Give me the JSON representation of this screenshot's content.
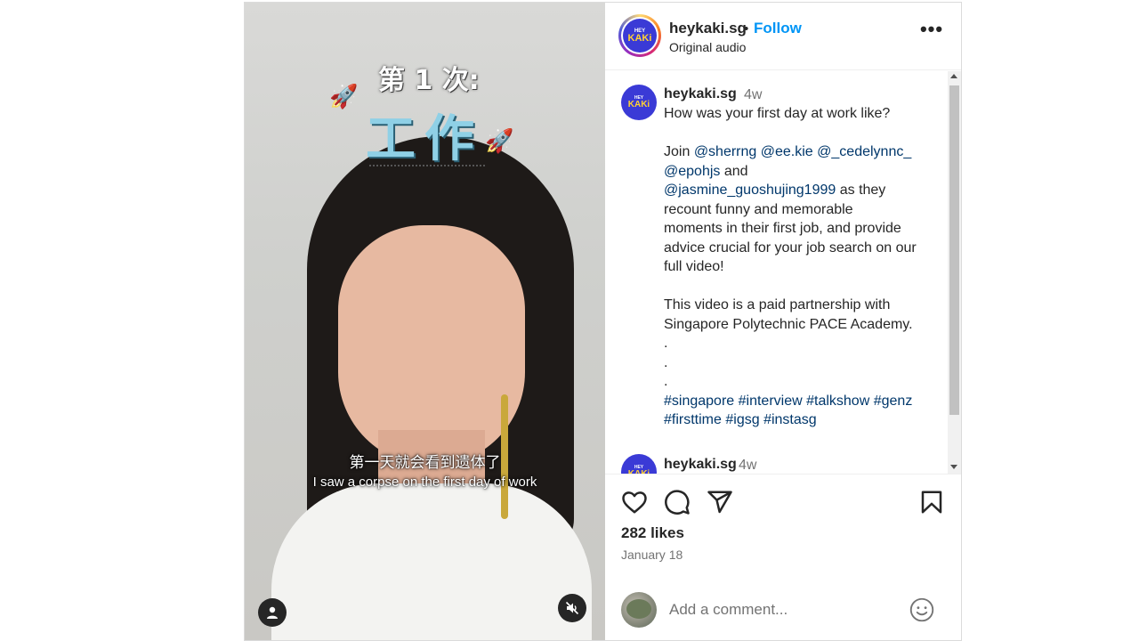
{
  "video": {
    "overlay_small": "第 1 次:",
    "overlay_big": "工作",
    "subtitle_cn": "第一天就会看到遗体了",
    "subtitle_en": "I saw a corpse on the first day of work"
  },
  "header": {
    "username": "heykaki.sg",
    "separator": "•",
    "follow_label": "Follow",
    "audio": "Original audio",
    "more_label": "•••",
    "logo_hey": "HEY",
    "logo_kaki": "KAKi"
  },
  "caption": {
    "username": "heykaki.sg",
    "time": "4w",
    "question": "How was your first day at work like?",
    "join": "Join",
    "mentions": [
      "@sherrng",
      "@ee.kie",
      "@_cedelynnc_",
      "@epohjs",
      "@jasmine_guoshujing1999"
    ],
    "and": "and",
    "body_1": "as they",
    "body_2": "recount funny and memorable",
    "body_3": "moments in their first job, and provide",
    "body_4": "advice crucial for your job search on our",
    "body_5": "full video!",
    "partner_1": "This video is a paid partnership with",
    "partner_2": "Singapore Polytechnic PACE Academy.",
    "dot": ".",
    "hashtags": [
      "#singapore",
      "#interview",
      "#talkshow",
      "#genz",
      "#firsttime",
      "#igsg",
      "#instasg"
    ]
  },
  "second_comment": {
    "username": "heykaki.sg",
    "time": "4w"
  },
  "actions": {
    "likes": "282 likes",
    "date": "January 18"
  },
  "add_comment": {
    "placeholder": "Add a comment..."
  },
  "colors": {
    "follow": "#0095f6",
    "mention": "#00376b",
    "brand": "#3a3ad6"
  }
}
